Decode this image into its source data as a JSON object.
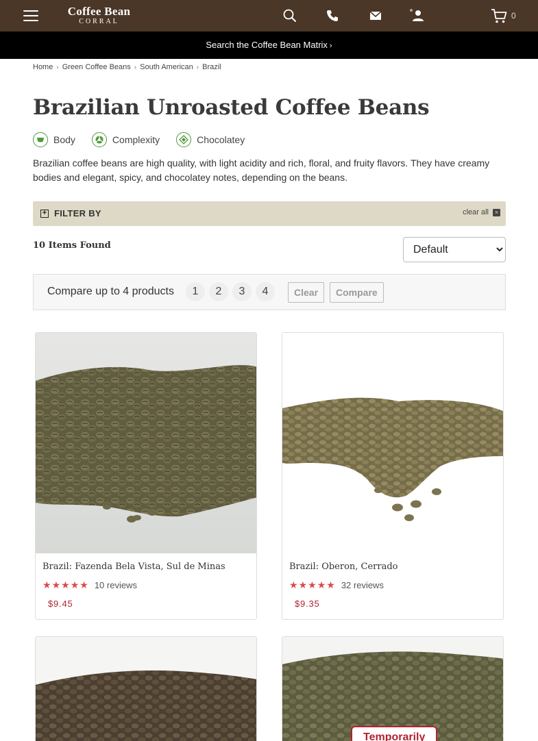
{
  "header": {
    "logo_line1": "Coffee Bean",
    "logo_line2": "CORRAL",
    "cart_count": "0"
  },
  "matrix_bar": {
    "label": "Search the Coffee Bean Matrix",
    "chevron": "›"
  },
  "breadcrumb": [
    "Home",
    "Green Coffee Beans",
    "South American",
    "Brazil"
  ],
  "page_title": "Brazilian Unroasted Coffee Beans",
  "flavors": [
    "Body",
    "Complexity",
    "Chocolatey"
  ],
  "description": "Brazilian coffee beans are high quality, with light acidity and rich, floral, and fruity flavors. They have creamy bodies and elegant, spicy, and chocolatey notes, depending on the beans.",
  "filter": {
    "label": "FILTER BY",
    "clear_all": "clear all"
  },
  "items_found": "10 Items Found",
  "sort": {
    "selected": "Default"
  },
  "compare": {
    "text": "Compare up to 4 products",
    "slots": [
      "1",
      "2",
      "3",
      "4"
    ],
    "clear_label": "Clear",
    "compare_label": "Compare"
  },
  "products": [
    {
      "name": "Brazil: Fazenda Bela Vista, Sul de Minas",
      "rating": 5,
      "reviews": "10 reviews",
      "price": "$9.45"
    },
    {
      "name": "Brazil: Oberon, Cerrado",
      "rating": 5,
      "reviews": "32 reviews",
      "price": "$9.35"
    },
    {
      "name": "",
      "rating": 0,
      "reviews": "",
      "price": ""
    },
    {
      "name": "",
      "rating": 0,
      "reviews": "",
      "price": "",
      "badge": "Temporarily"
    }
  ],
  "colors": {
    "header_bg": "#4a3728",
    "accent_red": "#b2222f",
    "filter_bg": "#ddd9c6",
    "flavor_green": "#4f9a3c"
  }
}
